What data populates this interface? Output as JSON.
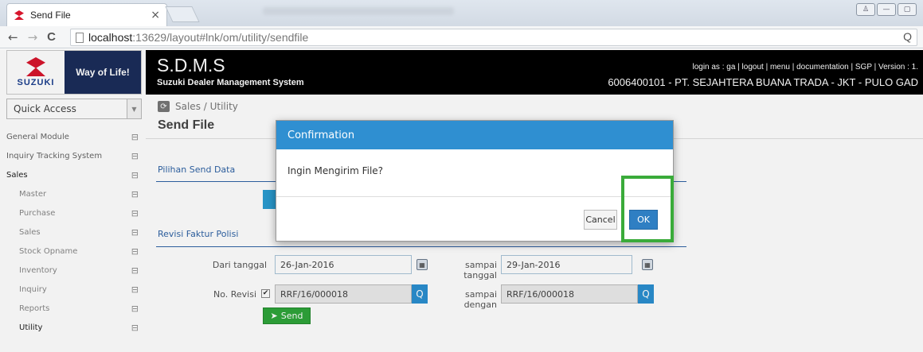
{
  "browser": {
    "tab_title": "Send File",
    "tab_close": "×",
    "url_host": "localhost",
    "url_path": ":13629/layout#lnk/om/utility/sendfile",
    "back": "←",
    "forward": "→",
    "reload": "C",
    "zoom": "Q"
  },
  "window_controls": [
    "♙",
    "—",
    "▢"
  ],
  "logo": {
    "brand": "SUZUKI",
    "slogan": "Way of Life!"
  },
  "header": {
    "title": "S.D.M.S",
    "subtitle": "Suzuki Dealer Management System",
    "links": "login as : ga | logout | menu | documentation | SGP | Version : 1.",
    "dealer": "6006400101 - PT. SEJAHTERA BUANA TRADA - JKT - PULO GAD"
  },
  "quick_access": {
    "label": "Quick Access",
    "arrow": "▼"
  },
  "sidebar": {
    "toggle": "⊟",
    "items": [
      {
        "label": "General Module",
        "sub": false
      },
      {
        "label": "Inquiry Tracking System",
        "sub": false
      },
      {
        "label": "Sales",
        "sub": false,
        "active": true
      },
      {
        "label": "Master",
        "sub": true
      },
      {
        "label": "Purchase",
        "sub": true
      },
      {
        "label": "Sales",
        "sub": true
      },
      {
        "label": "Stock Opname",
        "sub": true
      },
      {
        "label": "Inventory",
        "sub": true
      },
      {
        "label": "Inquiry",
        "sub": true
      },
      {
        "label": "Reports",
        "sub": true
      },
      {
        "label": "Utility",
        "sub": true,
        "active": true
      }
    ]
  },
  "breadcrumb": "Sales / Utility",
  "page_title": "Send File",
  "sections": {
    "send_data": "Pilihan Send Data",
    "revisi": "Revisi Faktur Polisi"
  },
  "form": {
    "dari_tanggal_label": "Dari tanggal",
    "dari_tanggal_value": "26-Jan-2016",
    "sampai_tanggal_label": "sampai tanggal",
    "sampai_tanggal_value": "29-Jan-2016",
    "no_revisi_label": "No. Revisi",
    "no_revisi_checked": "✔",
    "no_revisi_value": "RRF/16/000018",
    "sampai_dengan_label": "sampai dengan",
    "sampai_dengan_value": "RRF/16/000018",
    "calendar_glyph": "▦",
    "search_glyph": "Q",
    "send_icon": "➤",
    "send_label": "Send"
  },
  "modal": {
    "title": "Confirmation",
    "message": "Ingin Mengirim File?",
    "cancel_label": "Cancel",
    "ok_label": "OK"
  },
  "colors": {
    "accent": "#2f8fd1",
    "highlight": "#3aab3a",
    "send": "#2fa53a"
  }
}
